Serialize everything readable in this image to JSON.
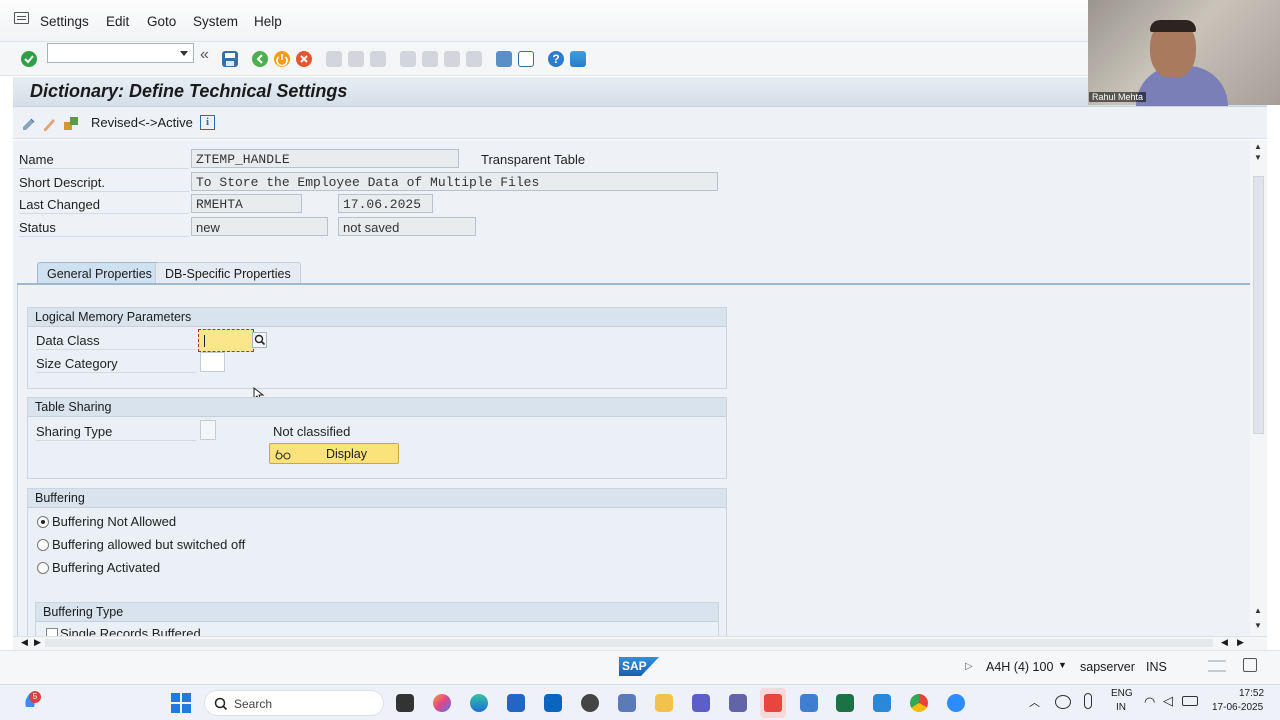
{
  "menu": {
    "items": [
      "Settings",
      "Edit",
      "Goto",
      "System",
      "Help"
    ]
  },
  "toolbar": {
    "command_field_value": ""
  },
  "page": {
    "title": "Dictionary: Define Technical Settings"
  },
  "app_toolbar": {
    "revised_active_label": "Revised<->Active"
  },
  "header": {
    "name_label": "Name",
    "name_value": "ZTEMP_HANDLE",
    "table_type": "Transparent Table",
    "short_desc_label": "Short Descript.",
    "short_desc_value": "To Store the Employee Data of Multiple Files",
    "last_changed_label": "Last Changed",
    "last_changed_user": "RMEHTA",
    "last_changed_date": "17.06.2025",
    "status_label": "Status",
    "status_value": "new",
    "status_save": "not saved"
  },
  "tabs": [
    {
      "label": "General Properties",
      "active": true
    },
    {
      "label": "DB-Specific Properties",
      "active": false
    }
  ],
  "logical_memory": {
    "title": "Logical Memory Parameters",
    "data_class_label": "Data Class",
    "data_class_value": "",
    "size_category_label": "Size Category",
    "size_category_value": ""
  },
  "table_sharing": {
    "title": "Table Sharing",
    "sharing_type_label": "Sharing Type",
    "classification": "Not classified",
    "display_button": "Display"
  },
  "buffering": {
    "title": "Buffering",
    "options": [
      {
        "label": "Buffering Not Allowed",
        "selected": true
      },
      {
        "label": "Buffering allowed but switched off",
        "selected": false
      },
      {
        "label": "Buffering Activated",
        "selected": false
      }
    ],
    "type_title": "Buffering Type",
    "type_first_option": "Single Records Buffered"
  },
  "statusbar": {
    "system": "A4H (4) 100",
    "server": "sapserver",
    "mode": "INS",
    "logo": "SAP"
  },
  "webcam": {
    "name": "Rahul Mehta"
  },
  "taskbar": {
    "search_placeholder": "Search",
    "badge": "5",
    "lang_top": "ENG",
    "lang_bottom": "IN",
    "time": "17:52",
    "date": "17-06-2025"
  },
  "colors": {
    "accent": "#0a6ed1",
    "field_focus": "#fbe78a",
    "button_yellow": "#fbe27a"
  }
}
